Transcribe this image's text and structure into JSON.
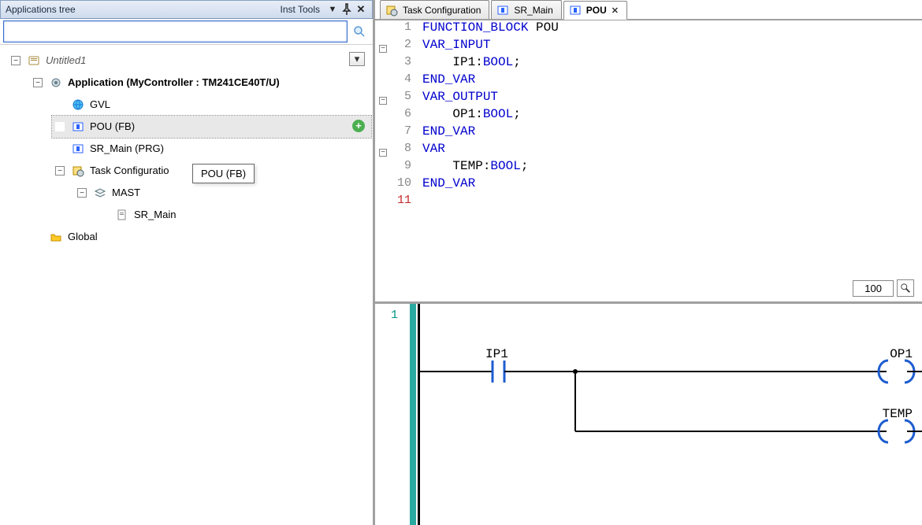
{
  "panel": {
    "title": "Applications tree",
    "rightLabel": "Inst Tools"
  },
  "search": {
    "value": "",
    "placeholder": ""
  },
  "tree": {
    "root": "Untitled1",
    "app": "Application (MyController : TM241CE40T/U)",
    "gvl": "GVL",
    "pou": "POU (FB)",
    "srmain": "SR_Main (PRG)",
    "taskconf": "Task Configuratio",
    "mast": "MAST",
    "mastchild": "SR_Main",
    "global": "Global"
  },
  "tooltip": "POU (FB)",
  "tabs": {
    "t0": "Task Configuration",
    "t1": "SR_Main",
    "t2": "POU"
  },
  "code": {
    "l1a": "FUNCTION_BLOCK",
    "l1b": " POU",
    "l2": "VAR_INPUT",
    "l3a": "    IP1:",
    "l3b": "BOOL",
    "l3c": ";",
    "l4": "END_VAR",
    "l5": "VAR_OUTPUT",
    "l6a": "    OP1:",
    "l6b": "BOOL",
    "l6c": ";",
    "l7": "END_VAR",
    "l8": "VAR",
    "l9a": "    TEMP:",
    "l9b": "BOOL",
    "l9c": ";",
    "l10": "END_VAR"
  },
  "linenos": {
    "n1": "1",
    "n2": "2",
    "n3": "3",
    "n4": "4",
    "n5": "5",
    "n6": "6",
    "n7": "7",
    "n8": "8",
    "n9": "9",
    "n10": "10",
    "n11": "11"
  },
  "zoom": "100",
  "ladder": {
    "rung": "1",
    "ip1": "IP1",
    "op1": "OP1",
    "temp": "TEMP"
  }
}
